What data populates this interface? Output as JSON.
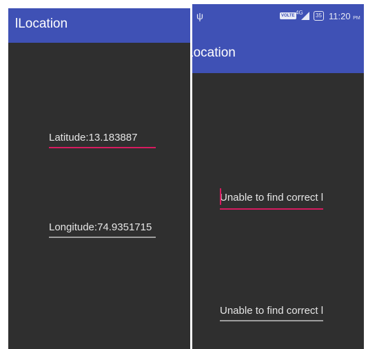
{
  "left_screen": {
    "app_title": "lLocation",
    "latitude_value": "Latitude:13.183887",
    "longitude_value": "Longitude:74.9351715"
  },
  "right_screen": {
    "status_bar": {
      "volte_label": "VOLTE",
      "network_label": "4G",
      "battery_label": "35",
      "time": "11:20",
      "time_suffix": "PM",
      "usb_icon": "usb-icon",
      "signal_icon": "signal-icon"
    },
    "app_title": "Location",
    "field_1_value": "Unable to find correct loca",
    "field_2_value": "Unable to find correct loca"
  },
  "colors": {
    "app_bar": "#3f51b5",
    "background": "#2f2f2f",
    "focused_underline": "#d81b60",
    "normal_underline": "#9e9e9e"
  }
}
